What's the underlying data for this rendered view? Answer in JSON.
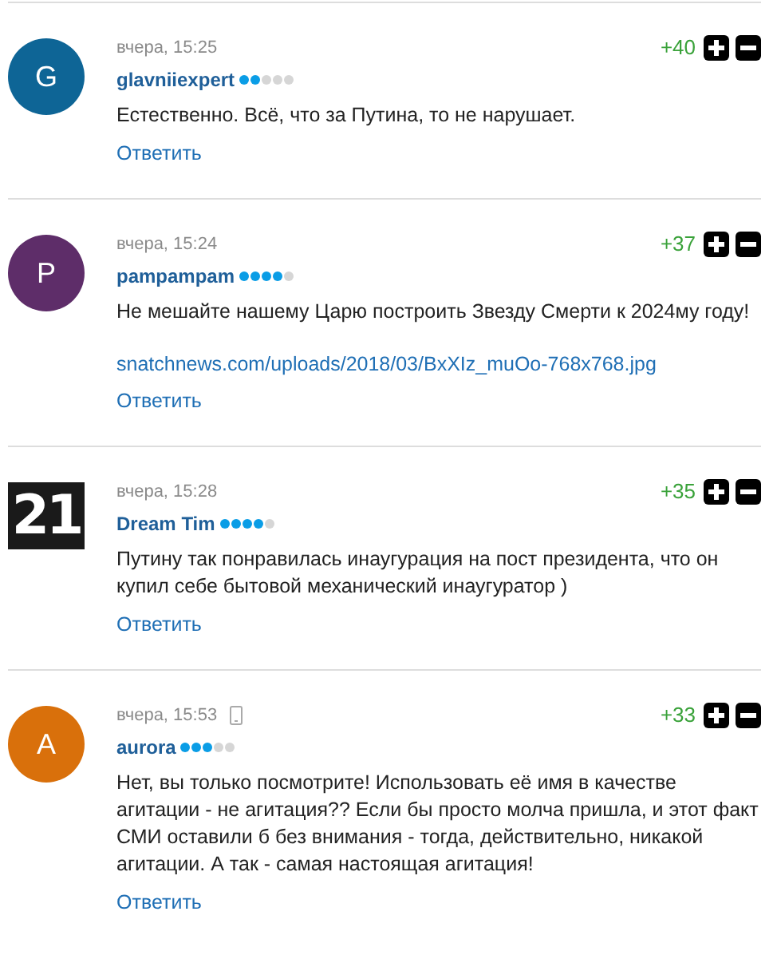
{
  "comments": [
    {
      "avatar": {
        "kind": "letter",
        "text": "G",
        "color": "#0e6596"
      },
      "time": "вчера, 15:25",
      "mobile": false,
      "author": "glavniiexpert",
      "stars": 2,
      "score": "+40",
      "text": "Естественно. Всё, что за Путина, то не нарушает.",
      "reply": "Ответить"
    },
    {
      "avatar": {
        "kind": "letter",
        "text": "P",
        "color": "#5e2d69"
      },
      "time": "вчера, 15:24",
      "mobile": false,
      "author": "pampampam",
      "stars": 4,
      "score": "+37",
      "text": "Не мешайте нашему Царю построить Звезду Смерти к 2024му году!",
      "link": "snatchnews.com/uploads/2018/03/BxXIz_muOo-768x768.jpg",
      "reply": "Ответить"
    },
    {
      "avatar": {
        "kind": "number",
        "text": "21",
        "color": "#1a1a1a"
      },
      "time": "вчера, 15:28",
      "mobile": false,
      "author": "Dream Tim",
      "stars": 4,
      "score": "+35",
      "text": "Путину так понравилась инаугурация на пост президента, что он купил себе бытовой механический инаугуратор )",
      "reply": "Ответить"
    },
    {
      "avatar": {
        "kind": "letter",
        "text": "A",
        "color": "#d9700b"
      },
      "time": "вчера, 15:53",
      "mobile": true,
      "author": "aurora",
      "stars": 3,
      "score": "+33",
      "text": "Нет, вы только посмотрите! Использовать её имя в качестве агитации - не агитация?? Если бы просто молча пришла, и этот факт СМИ оставили б без внимания - тогда, действительно, никакой агитации. А так - самая настоящая агитация!",
      "reply": "Ответить"
    }
  ]
}
